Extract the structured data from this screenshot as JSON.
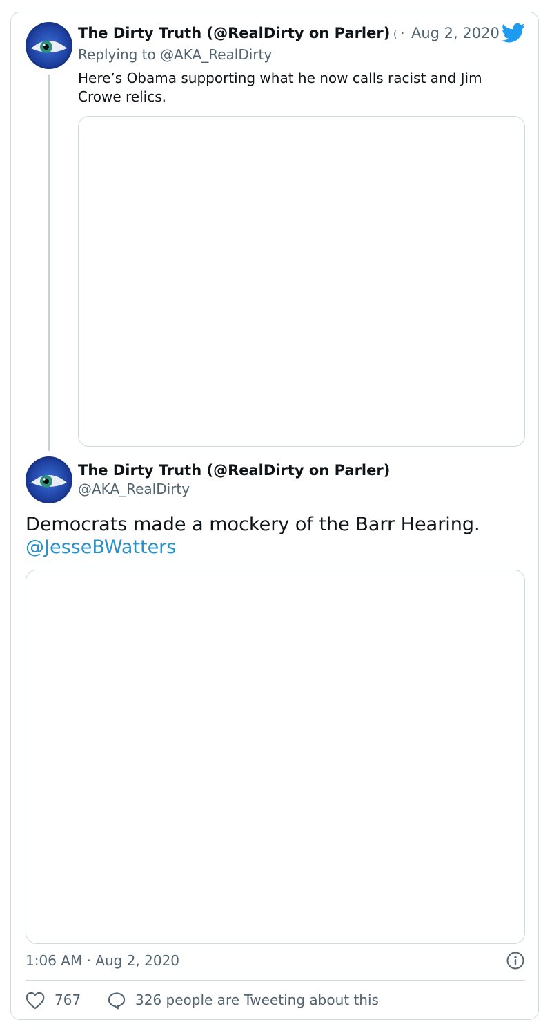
{
  "quoted_tweet": {
    "display_name": "The Dirty Truth (@RealDirty on Parler)",
    "handle_fragment": "(",
    "separator": "·",
    "date": "Aug 2, 2020",
    "replying_to": "Replying to @AKA_RealDirty",
    "text": "Here’s Obama supporting what he now calls racist and Jim Crowe relics."
  },
  "main_tweet": {
    "display_name": "The Dirty Truth (@RealDirty on Parler)",
    "handle": "@AKA_RealDirty",
    "text": "Democrats made a mockery of the Barr Hearing.",
    "mention": "@JesseBWatters",
    "timestamp": "1:06 AM · Aug 2, 2020"
  },
  "actions": {
    "like_count": "767",
    "reply_text": "326 people are Tweeting about this"
  },
  "icons": {
    "brand": "twitter-bird-icon",
    "info": "info-icon",
    "like": "heart-icon",
    "reply": "comment-icon"
  },
  "colors": {
    "brand_blue": "#1d9bf0",
    "mention_blue": "#2b8fca",
    "secondary_text": "#536471",
    "border": "#cfd9de"
  }
}
